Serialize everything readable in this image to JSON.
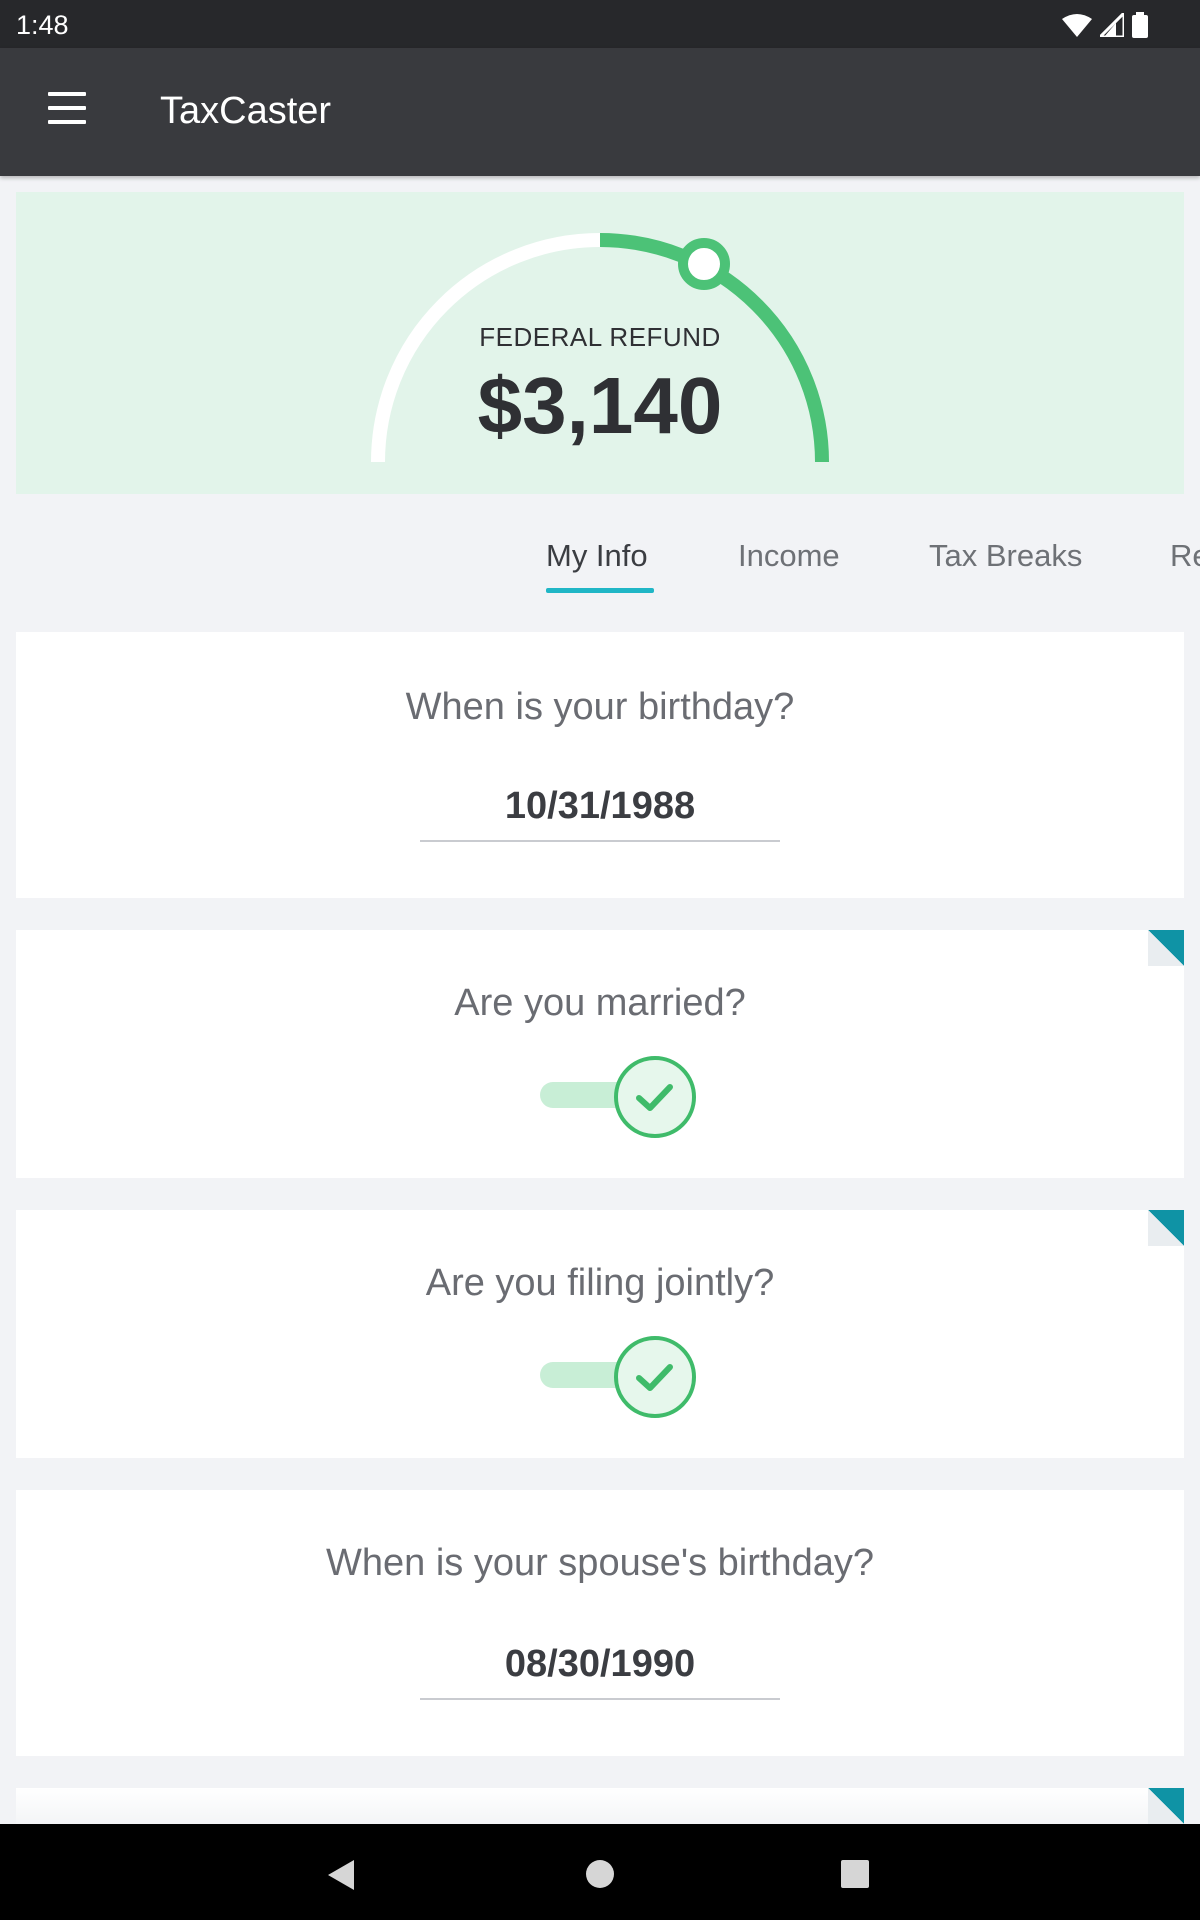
{
  "status_bar": {
    "time": "1:48"
  },
  "app_bar": {
    "title": "TaxCaster"
  },
  "refund": {
    "label": "FEDERAL REFUND",
    "amount": "$3,140"
  },
  "tabs": [
    {
      "label": "My Info",
      "active": true
    },
    {
      "label": "Income",
      "active": false
    },
    {
      "label": "Tax Breaks",
      "active": false
    },
    {
      "label": "Re",
      "active": false
    }
  ],
  "questions": {
    "birthday": {
      "question": "When is your birthday?",
      "value": "10/31/1988"
    },
    "married": {
      "question": "Are you married?",
      "checked": true
    },
    "filing_jointly": {
      "question": "Are you filing jointly?",
      "checked": true
    },
    "spouse_birthday": {
      "question": "When is your spouse's birthday?",
      "value": "08/30/1990"
    }
  },
  "colors": {
    "accent_green": "#3fbb6a",
    "tab_indicator": "#20b6c6",
    "corner_flag": "#0f93a5",
    "app_bar": "#393a3e"
  },
  "icons": [
    "menu-icon",
    "wifi-icon",
    "signal-icon",
    "battery-icon",
    "check-icon",
    "back-icon",
    "home-icon",
    "recents-icon"
  ]
}
